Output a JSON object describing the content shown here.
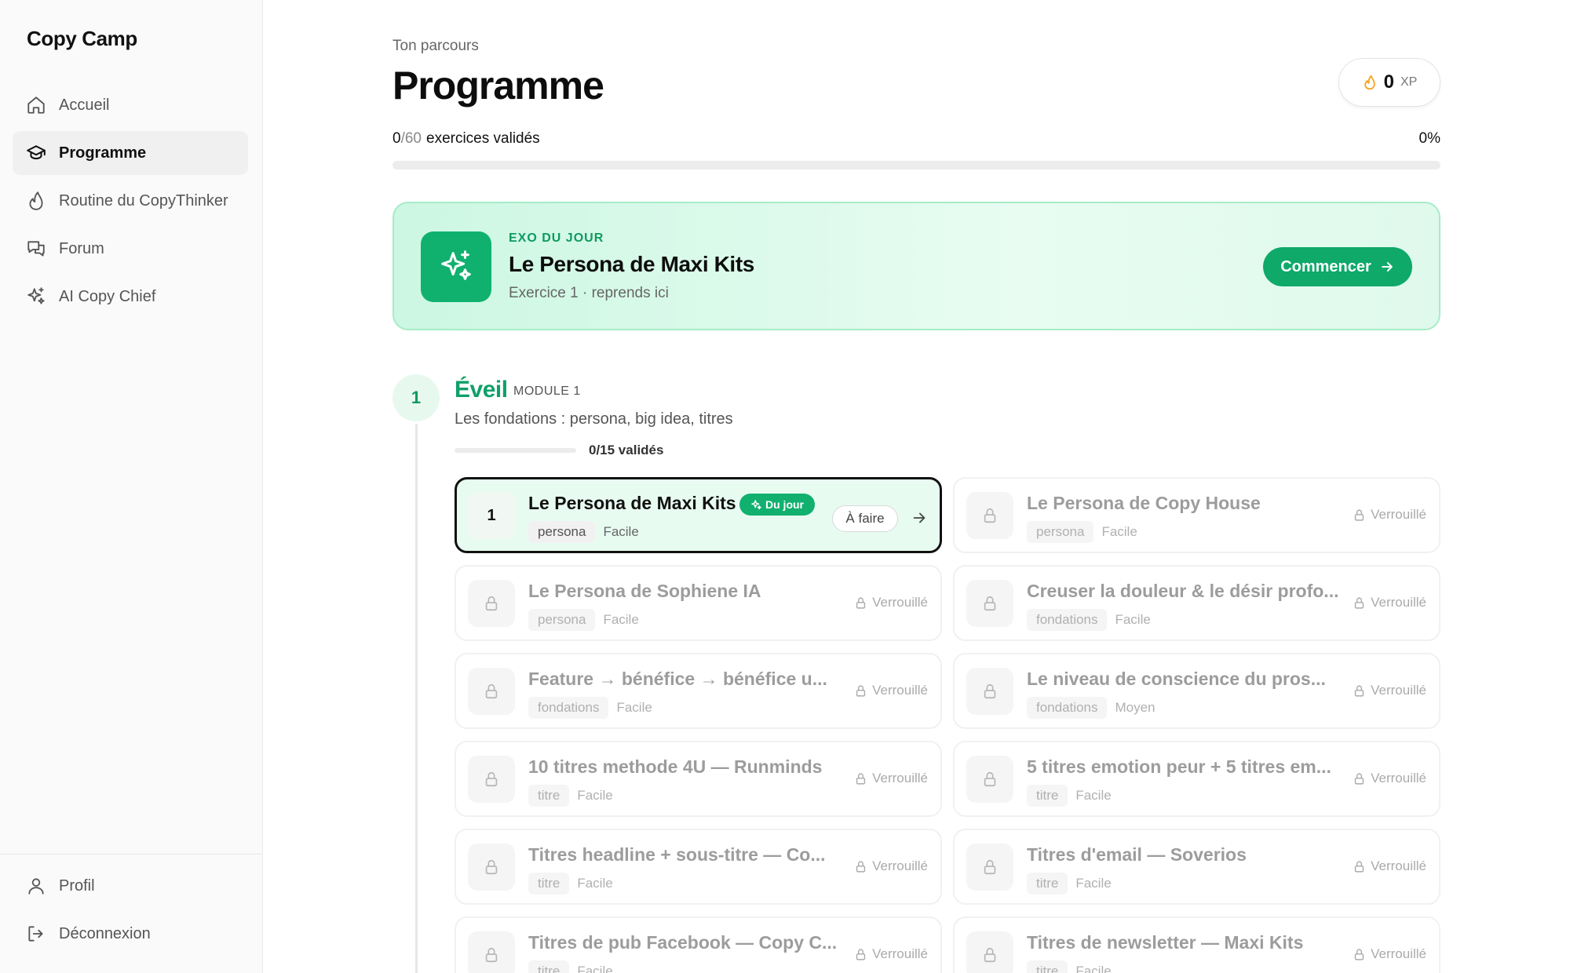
{
  "app": {
    "brand": "Copy Camp"
  },
  "sidebar": {
    "items": [
      {
        "label": "Accueil",
        "icon": "home-icon"
      },
      {
        "label": "Programme",
        "icon": "graduation-cap-icon"
      },
      {
        "label": "Routine du CopyThinker",
        "icon": "flame-icon"
      },
      {
        "label": "Forum",
        "icon": "chat-bubbles-icon"
      },
      {
        "label": "AI Copy Chief",
        "icon": "sparkles-icon"
      }
    ],
    "active_index": 1,
    "bottom": [
      {
        "label": "Profil",
        "icon": "user-icon"
      },
      {
        "label": "Déconnexion",
        "icon": "logout-icon"
      }
    ]
  },
  "header": {
    "eyebrow": "Ton parcours",
    "title": "Programme",
    "xp_value": "0",
    "xp_unit": "XP"
  },
  "progress": {
    "done": "0",
    "total": "/60",
    "label": "exercices validés",
    "percent_text": "0%",
    "fraction": 0
  },
  "daily": {
    "kicker": "EXO DU JOUR",
    "title": "Le Persona de Maxi Kits",
    "subtitle": "Exercice 1 · reprends ici",
    "button": "Commencer"
  },
  "module": {
    "number": "1",
    "title": "Éveil",
    "tag": "MODULE 1",
    "description": "Les fondations : persona, big idea, titres",
    "count": "0/15 validés",
    "fraction": 0
  },
  "exercises": [
    {
      "num": "1",
      "title": "Le Persona de Maxi Kits",
      "tag": "persona",
      "level": "Facile",
      "status": "À faire",
      "badge": "Du jour",
      "current": true
    },
    {
      "title": "Le Persona de Copy House",
      "tag": "persona",
      "level": "Facile",
      "status": "Verrouillé"
    },
    {
      "title": "Le Persona de Sophiene IA",
      "tag": "persona",
      "level": "Facile",
      "status": "Verrouillé"
    },
    {
      "title": "Creuser la douleur & le désir profo...",
      "tag": "fondations",
      "level": "Facile",
      "status": "Verrouillé"
    },
    {
      "title": "Feature → bénéfice → bénéfice u...",
      "tag": "fondations",
      "level": "Facile",
      "status": "Verrouillé"
    },
    {
      "title": "Le niveau de conscience du pros...",
      "tag": "fondations",
      "level": "Moyen",
      "status": "Verrouillé"
    },
    {
      "title": "10 titres methode 4U — Runminds",
      "tag": "titre",
      "level": "Facile",
      "status": "Verrouillé"
    },
    {
      "title": "5 titres emotion peur + 5 titres em...",
      "tag": "titre",
      "level": "Facile",
      "status": "Verrouillé"
    },
    {
      "title": "Titres headline + sous-titre — Co...",
      "tag": "titre",
      "level": "Facile",
      "status": "Verrouillé"
    },
    {
      "title": "Titres d'email — Soverios",
      "tag": "titre",
      "level": "Facile",
      "status": "Verrouillé"
    },
    {
      "title": "Titres de pub Facebook — Copy C...",
      "tag": "titre",
      "level": "Facile",
      "status": "Verrouillé"
    },
    {
      "title": "Titres de newsletter — Maxi Kits",
      "tag": "titre",
      "level": "Facile",
      "status": "Verrouillé"
    }
  ],
  "colors": {
    "accent": "#0fa96a",
    "accent_text": "#0d9a5e",
    "locked_text": "#9c9c9c",
    "flame": "#f5a623"
  }
}
